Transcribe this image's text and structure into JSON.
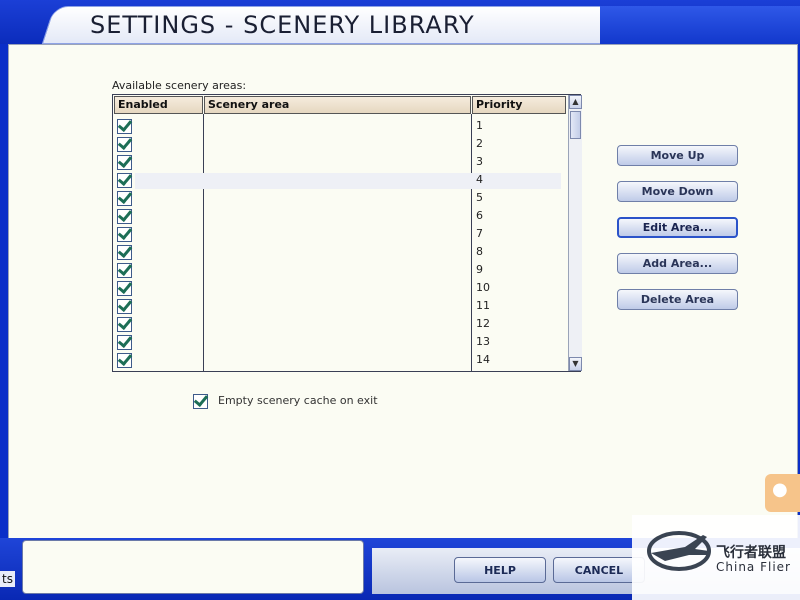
{
  "window": {
    "title": "SETTINGS - SCENERY LIBRARY"
  },
  "table": {
    "label": "Available scenery areas:",
    "columns": [
      "Enabled",
      "Scenery area",
      "Priority"
    ],
    "rows": [
      {
        "enabled": true,
        "area": "",
        "priority": "1"
      },
      {
        "enabled": true,
        "area": "",
        "priority": "2"
      },
      {
        "enabled": true,
        "area": "",
        "priority": "3"
      },
      {
        "enabled": true,
        "area": "",
        "priority": "4"
      },
      {
        "enabled": true,
        "area": "",
        "priority": "5"
      },
      {
        "enabled": true,
        "area": "",
        "priority": "6"
      },
      {
        "enabled": true,
        "area": "",
        "priority": "7"
      },
      {
        "enabled": true,
        "area": "",
        "priority": "8"
      },
      {
        "enabled": true,
        "area": "",
        "priority": "9"
      },
      {
        "enabled": true,
        "area": "",
        "priority": "10"
      },
      {
        "enabled": true,
        "area": "",
        "priority": "11"
      },
      {
        "enabled": true,
        "area": "",
        "priority": "12"
      },
      {
        "enabled": true,
        "area": "",
        "priority": "13"
      },
      {
        "enabled": true,
        "area": "",
        "priority": "14"
      }
    ]
  },
  "actions": {
    "move_up": "Move Up",
    "move_down": "Move Down",
    "edit_area": "Edit Area...",
    "add_area": "Add Area...",
    "delete_area": "Delete Area"
  },
  "options": {
    "empty_cache": "Empty scenery cache on exit",
    "empty_cache_checked": true
  },
  "footer": {
    "help": "HELP",
    "cancel": "CANCEL",
    "side_text": "ts"
  },
  "watermark": {
    "cn": "飞行者联盟",
    "en": "China Flier"
  },
  "colors": {
    "frame": "#0a2ec8",
    "panel": "#fbfcf3",
    "check": "#1d6e56"
  }
}
